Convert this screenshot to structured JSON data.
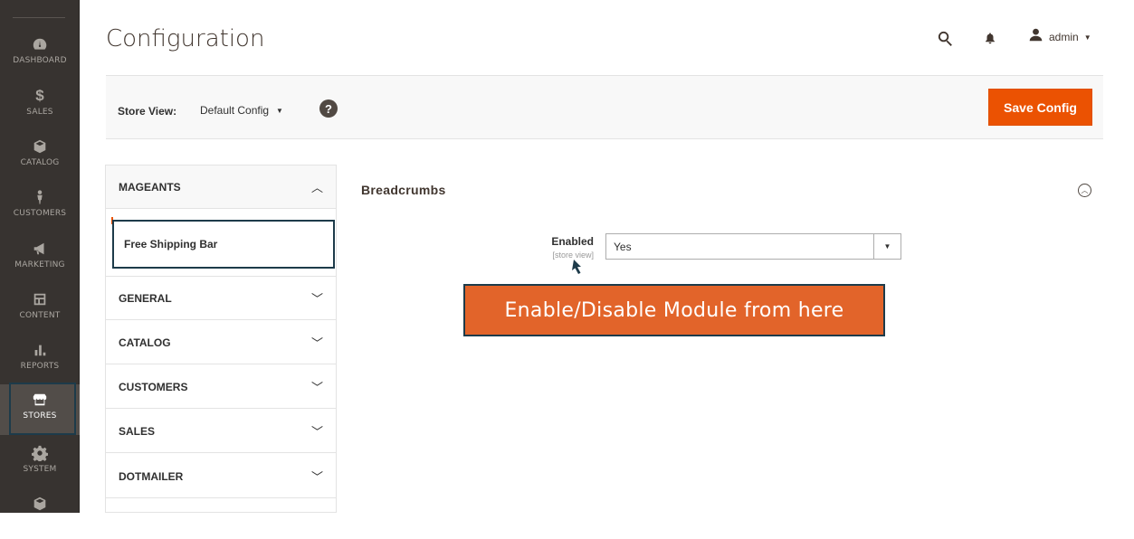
{
  "nav": {
    "items": [
      {
        "label": "DASHBOARD",
        "icon": "dashboard-icon"
      },
      {
        "label": "SALES",
        "icon": "dollar-icon"
      },
      {
        "label": "CATALOG",
        "icon": "box-icon"
      },
      {
        "label": "CUSTOMERS",
        "icon": "person-icon"
      },
      {
        "label": "MARKETING",
        "icon": "megaphone-icon"
      },
      {
        "label": "CONTENT",
        "icon": "layout-icon"
      },
      {
        "label": "REPORTS",
        "icon": "bar-chart-icon"
      },
      {
        "label": "STORES",
        "icon": "storefront-icon"
      },
      {
        "label": "SYSTEM",
        "icon": "gear-icon"
      },
      {
        "label": "",
        "icon": "cube-icon"
      }
    ],
    "active": "STORES"
  },
  "header": {
    "title": "Configuration",
    "user": "admin"
  },
  "scope": {
    "label": "Store View:",
    "value": "Default Config",
    "help": "?"
  },
  "toolbar": {
    "save_label": "Save Config"
  },
  "tabs": {
    "mageants": {
      "label": "MAGEANTS",
      "sub_item": "Free Shipping Bar"
    },
    "groups": [
      {
        "label": "GENERAL"
      },
      {
        "label": "CATALOG"
      },
      {
        "label": "CUSTOMERS"
      },
      {
        "label": "SALES"
      },
      {
        "label": "DOTMAILER"
      }
    ]
  },
  "section": {
    "title": "Breadcrumbs",
    "field": {
      "label": "Enabled",
      "scope": "[store view]",
      "value": "Yes"
    }
  },
  "annotation": {
    "text": "Enable/Disable Module from here"
  },
  "colors": {
    "nav_bg": "#373330",
    "accent": "#eb5202",
    "callout_bg": "#e2642a",
    "outline": "#1d3b4a"
  }
}
